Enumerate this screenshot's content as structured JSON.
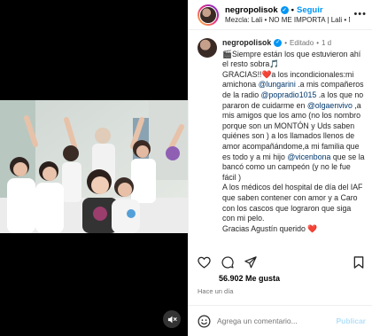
{
  "header": {
    "username": "negropolisok",
    "separator": "•",
    "follow_label": "Seguir",
    "music_line": "Mezcla: Lali • NO ME IMPORTA | Lali • NEGRO"
  },
  "caption": {
    "username": "negropolisok",
    "edited": "Editado",
    "dot": "•",
    "time": "1 d",
    "segments": [
      {
        "t": "🎬Siempre están los que estuvieron ahí el resto sobra🎵"
      },
      {
        "t": "GRACIAS!!❤️a los incondicionales:mi amichona "
      },
      {
        "t": "@lungarini",
        "m": true
      },
      {
        "t": " .a mis compañeros de la radio "
      },
      {
        "t": "@popradio1015",
        "m": true
      },
      {
        "t": " .a los que no pararon de cuidarme en "
      },
      {
        "t": "@olgaenvivo",
        "m": true
      },
      {
        "t": " ,a mis amigos que los amo (no los nombro porque son un MONTÓN y Uds saben quiénes son ) a los llamados llenos de amor acompañándome,a mi familia que es todo y a mi hijo "
      },
      {
        "t": "@vicenbona",
        "m": true
      },
      {
        "t": " que se la bancó como un campeón (y no le fue fácil )"
      },
      {
        "t": "A los médicos del hospital de día del IAF que saben contener con amor y a Caro con los cascos que lograron que siga con mi pelo."
      },
      {
        "t": "Gracias Agustín querido ❤️"
      }
    ]
  },
  "likes": "56.902 Me gusta",
  "time_ago": "Hace un día",
  "comment": {
    "placeholder": "Agrega un comentario...",
    "publish_label": "Publicar"
  },
  "colors": {
    "accent": "#0095f6",
    "mention": "#00376b",
    "heart": "#ed4956"
  }
}
